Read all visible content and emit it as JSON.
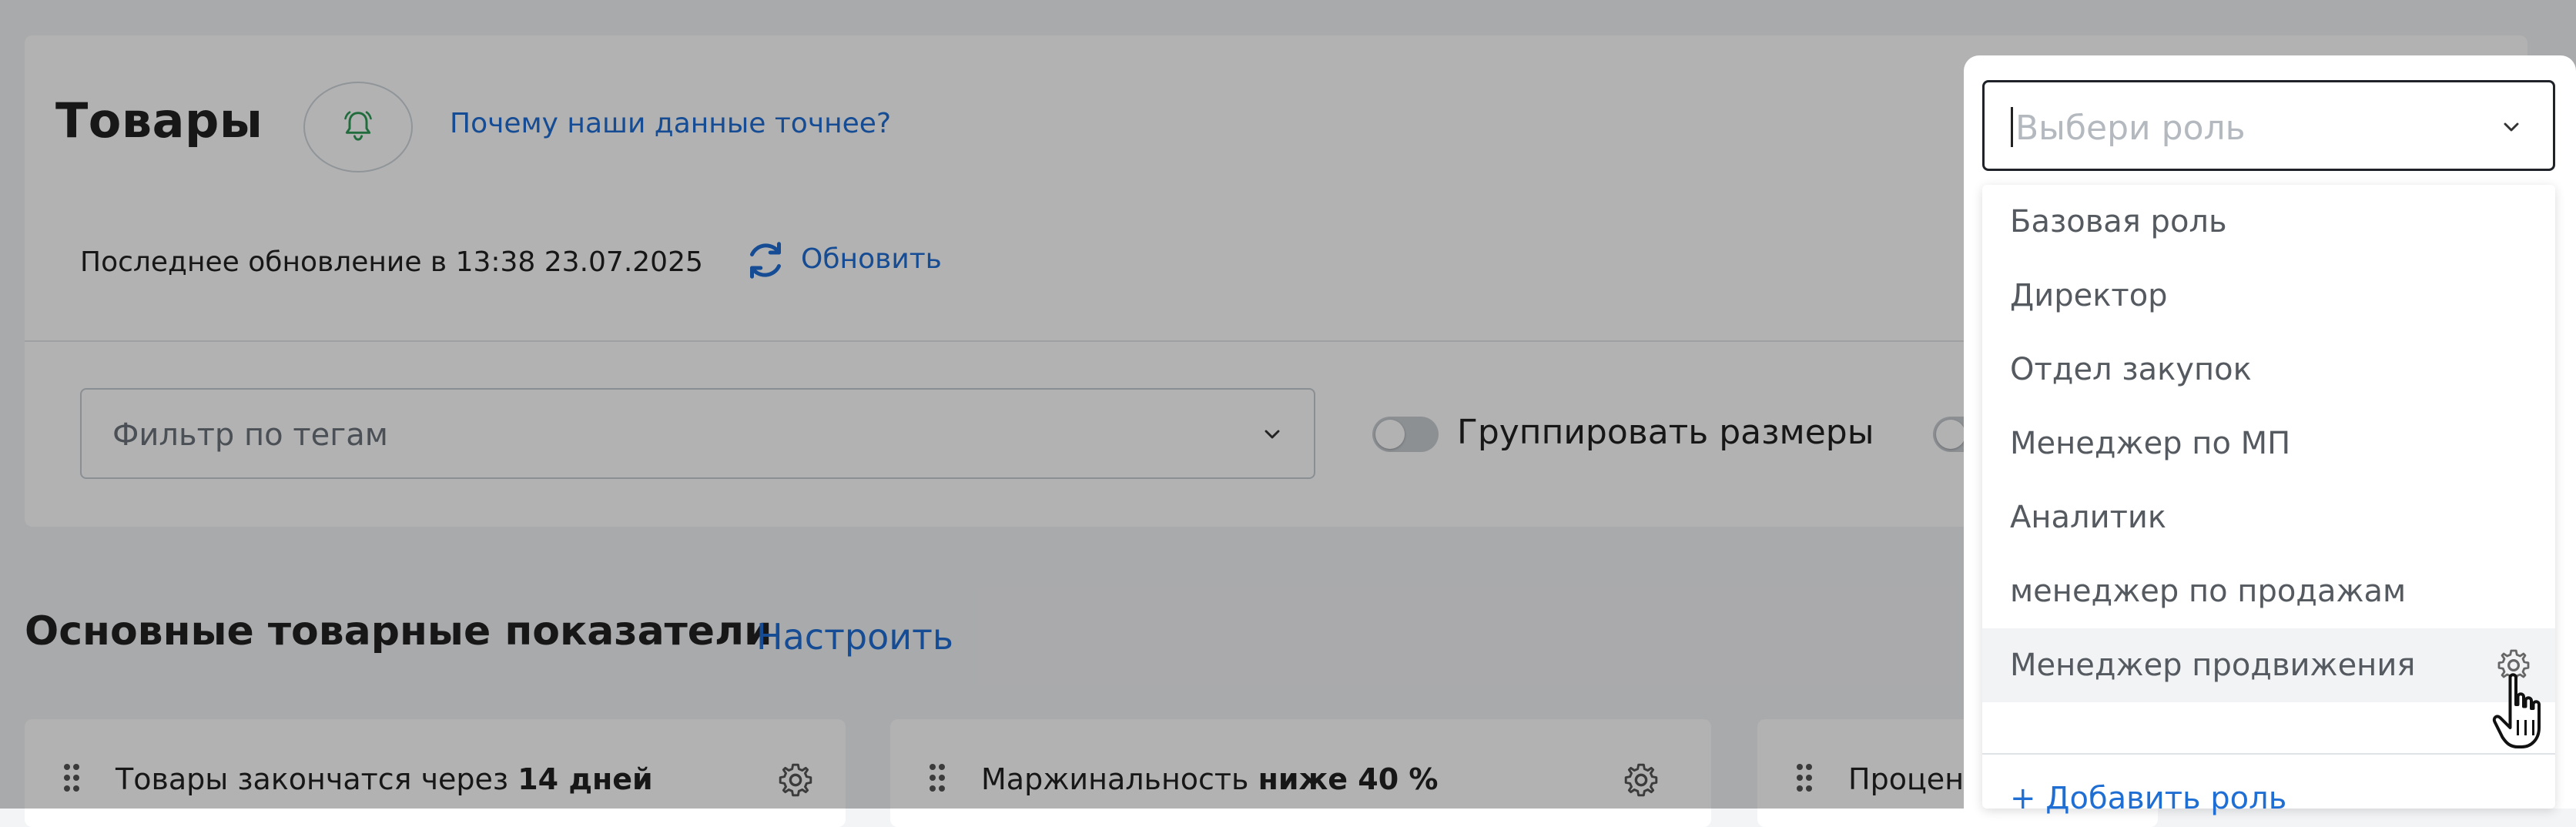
{
  "header": {
    "title": "Товары",
    "why_link": "Почему наши данные точнее?",
    "last_update": "Последнее обновление в 13:38 23.07.2025",
    "refresh_label": "Обновить"
  },
  "filters": {
    "tag_filter_placeholder": "Фильтр по тегам",
    "group_sizes_label": "Группировать размеры"
  },
  "section": {
    "title": "Основные товарные показатели",
    "configure_label": "Настроить"
  },
  "metrics": [
    {
      "text": "Товары закончатся через",
      "bold": "14 дней"
    },
    {
      "text": "Маржинальность",
      "bold": "ниже 40 %"
    },
    {
      "text": "Процент",
      "bold": ""
    }
  ],
  "role_dropdown": {
    "placeholder": "Выбери роль",
    "items": [
      "Базовая роль",
      "Директор",
      "Отдел закупок",
      "Менеджер по МП",
      "Аналитик",
      "менеджер по продажам",
      "Менеджер продвижения"
    ],
    "hovered_index": 6,
    "add_label": "+ Добавить роль"
  },
  "icons": {
    "bell": "bell-icon",
    "refresh": "refresh-icon",
    "chevron": "chevron-down-icon",
    "gear": "gear-icon",
    "drag": "drag-handle-icon",
    "cursor": "hand-pointer-icon"
  },
  "colors": {
    "accent": "#1f6ed4",
    "bell_green": "#2e9b57",
    "overlay": "rgba(0,0,0,0.3)"
  }
}
